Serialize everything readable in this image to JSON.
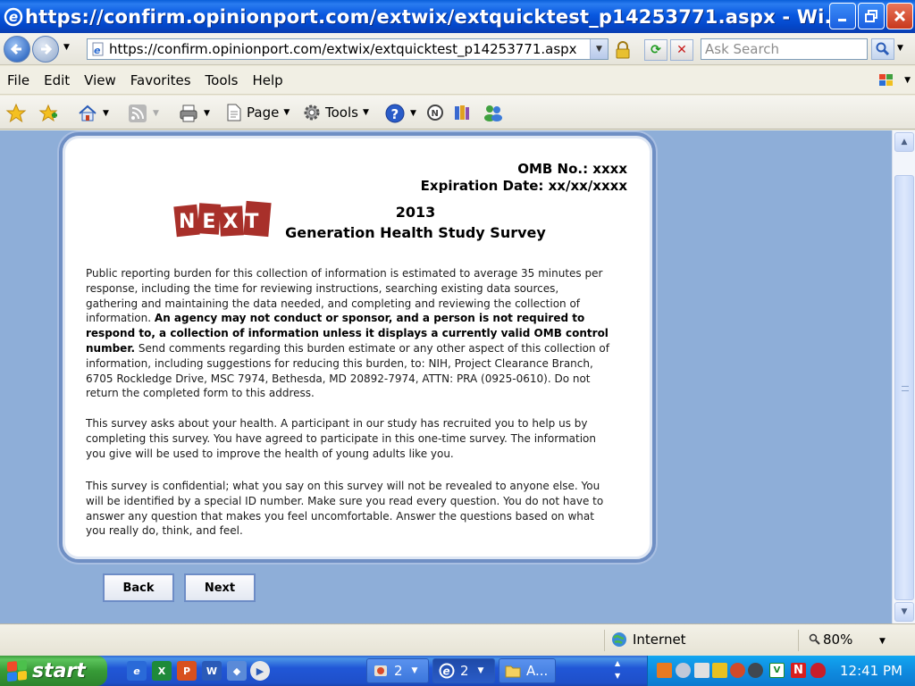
{
  "window": {
    "title": "https://confirm.opinionport.com/extwix/extquicktest_p14253771.aspx - Wi..."
  },
  "address_bar": {
    "url": "https://confirm.opinionport.com/extwix/extquicktest_p14253771.aspx",
    "search_placeholder": "Ask Search"
  },
  "menu": {
    "items": [
      "File",
      "Edit",
      "View",
      "Favorites",
      "Tools",
      "Help"
    ]
  },
  "command_bar": {
    "page_label": "Page",
    "tools_label": "Tools"
  },
  "page": {
    "omb_number": "OMB No.: xxxx",
    "expiration": "Expiration Date: xx/xx/xxxx",
    "logo_text": "NEXT",
    "title_year": "2013",
    "title_name": "Generation Health Study Survey",
    "paragraph1_part1": "Public reporting burden for this collection of information is estimated to average 35 minutes per response, including the time for reviewing instructions, searching existing data sources, gathering and maintaining the data needed, and completing and reviewing the collection of information.",
    "paragraph1_bold": "An agency may not conduct or sponsor, and a person is not required to respond to, a collection of information unless it displays a currently valid OMB control number.",
    "paragraph1_part2": "Send comments regarding this burden estimate or any other aspect of this collection of information, including suggestions for reducing this burden, to: NIH, Project Clearance Branch, 6705 Rockledge Drive, MSC 7974, Bethesda, MD 20892-7974, ATTN: PRA (0925-0610). Do not return the completed form to this address.",
    "paragraph2": "This survey asks about your health. A participant in our study has recruited you to help us by completing this survey. You have agreed to participate in this one-time survey. The information you give will be used to improve the health of young adults like you.",
    "paragraph3": "This survey is confidential; what you say on this survey will not be revealed to anyone else. You will be identified by a special ID number. Make sure you read every question. You do not have to answer any question that makes you feel uncomfortable. Answer the questions based on what you really do, think, and feel.",
    "back_label": "Back",
    "next_label": "Next"
  },
  "status_bar": {
    "zone": "Internet",
    "zoom": "80%"
  },
  "taskbar": {
    "start_label": "start",
    "groups": [
      {
        "count": "2"
      },
      {
        "count": "2"
      },
      {
        "label": "A..."
      }
    ],
    "clock": "12:41 PM"
  },
  "colors": {
    "page_background": "#8eaed8",
    "card_border": "#6f8fc4",
    "logo_red": "#a8302a"
  }
}
